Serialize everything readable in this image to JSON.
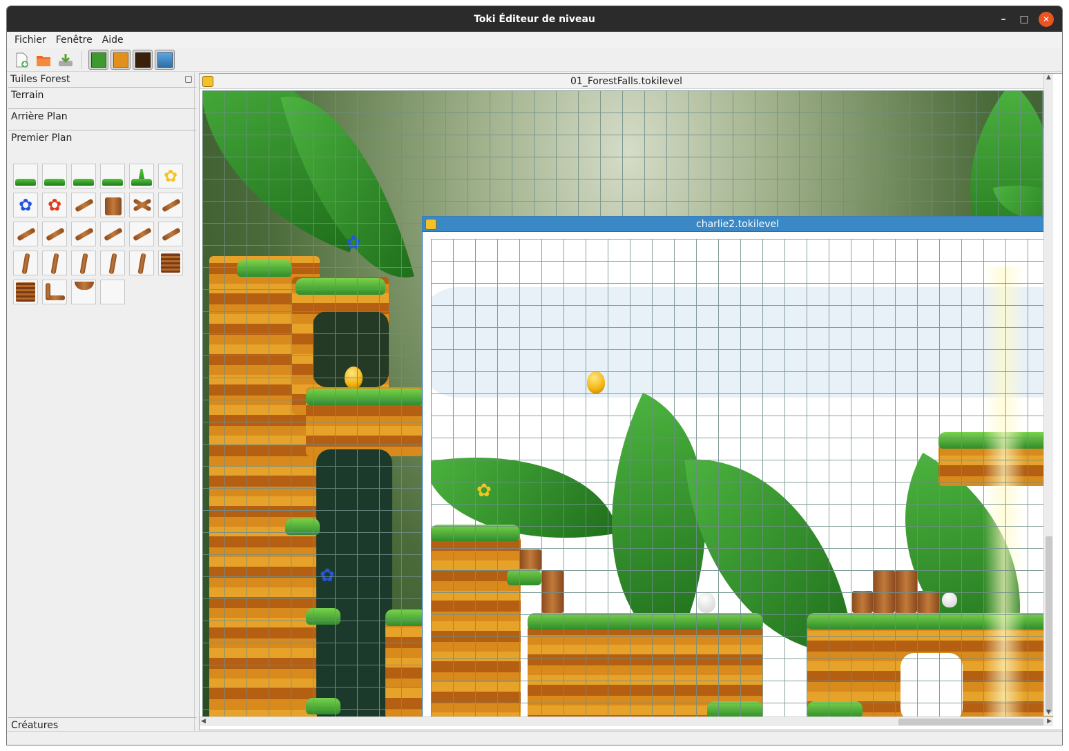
{
  "window": {
    "title": "Toki Éditeur de niveau",
    "minimize": "–",
    "maximize": "□",
    "close": "✕"
  },
  "menu": {
    "items": [
      "Fichier",
      "Fenêtre",
      "Aide"
    ]
  },
  "toolbar": {
    "buttons": [
      {
        "name": "new-file-icon"
      },
      {
        "name": "open-folder-icon"
      },
      {
        "name": "save-icon"
      },
      {
        "name": "tiles-forest-icon"
      },
      {
        "name": "tiles-terrain-icon"
      },
      {
        "name": "tiles-dark-icon"
      },
      {
        "name": "background-image-icon"
      }
    ],
    "colors": {
      "forest": "#3e9a2e",
      "terrain": "#e2901d",
      "dark": "#3a1f0a"
    }
  },
  "dock": {
    "title": "Tuiles Forest",
    "sections": [
      "Terrain",
      "Arrière Plan",
      "Premier Plan"
    ],
    "bottom_section": "Créatures",
    "tiles": [
      "grass-tile",
      "grass-tile",
      "grass-tile",
      "grass-tile",
      "tall-grass-tile",
      "yellow-flower-tile",
      "blue-flower-tile",
      "red-flower-tile",
      "branch-tile",
      "stump-tile",
      "crossed-branch-tile",
      "branch-tile",
      "branch-tile",
      "branch-tile",
      "branch-tile",
      "branch-tile",
      "branch-tile",
      "branch-tile",
      "root-tile",
      "root-tile",
      "root-tile",
      "root-tile",
      "root-tile",
      "log-end-tile",
      "wood-block-tile",
      "root-corner-tile",
      "half-log-tile",
      "empty-tile"
    ]
  },
  "documents": [
    {
      "title": "01_ForestFalls.tokilevel"
    },
    {
      "title": "charlie2.tokilevel"
    }
  ]
}
